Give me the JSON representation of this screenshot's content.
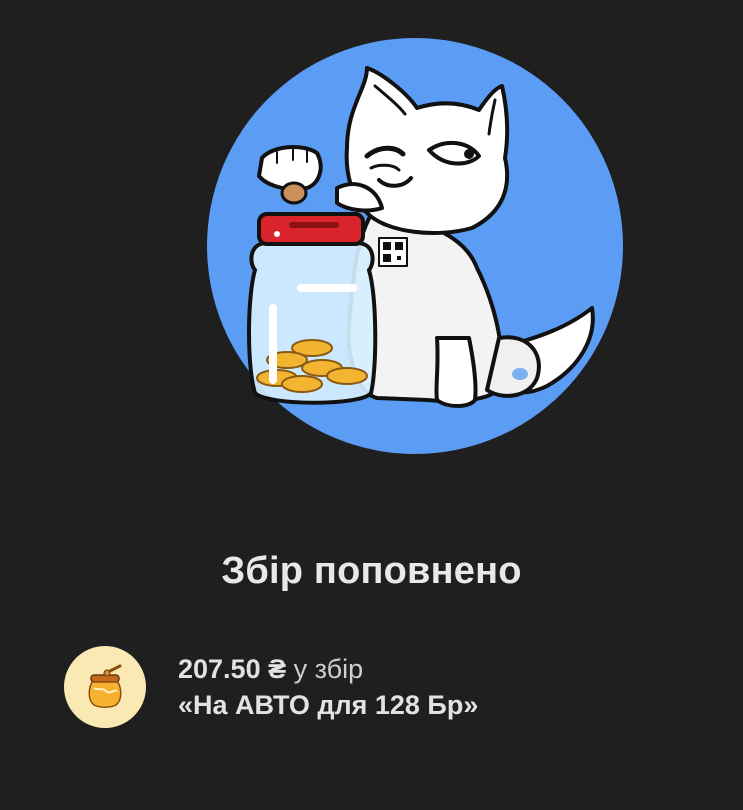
{
  "hero": {
    "illustration": "cat-with-coin-jar-icon",
    "circle_color": "#5b9cf5"
  },
  "title": "Збір поповнено",
  "receipt": {
    "icon": "honey-jar-icon",
    "amount": "207.50 ₴",
    "suffix": "у збір",
    "jar_name": "«На АВТО для 128 Бр»"
  }
}
